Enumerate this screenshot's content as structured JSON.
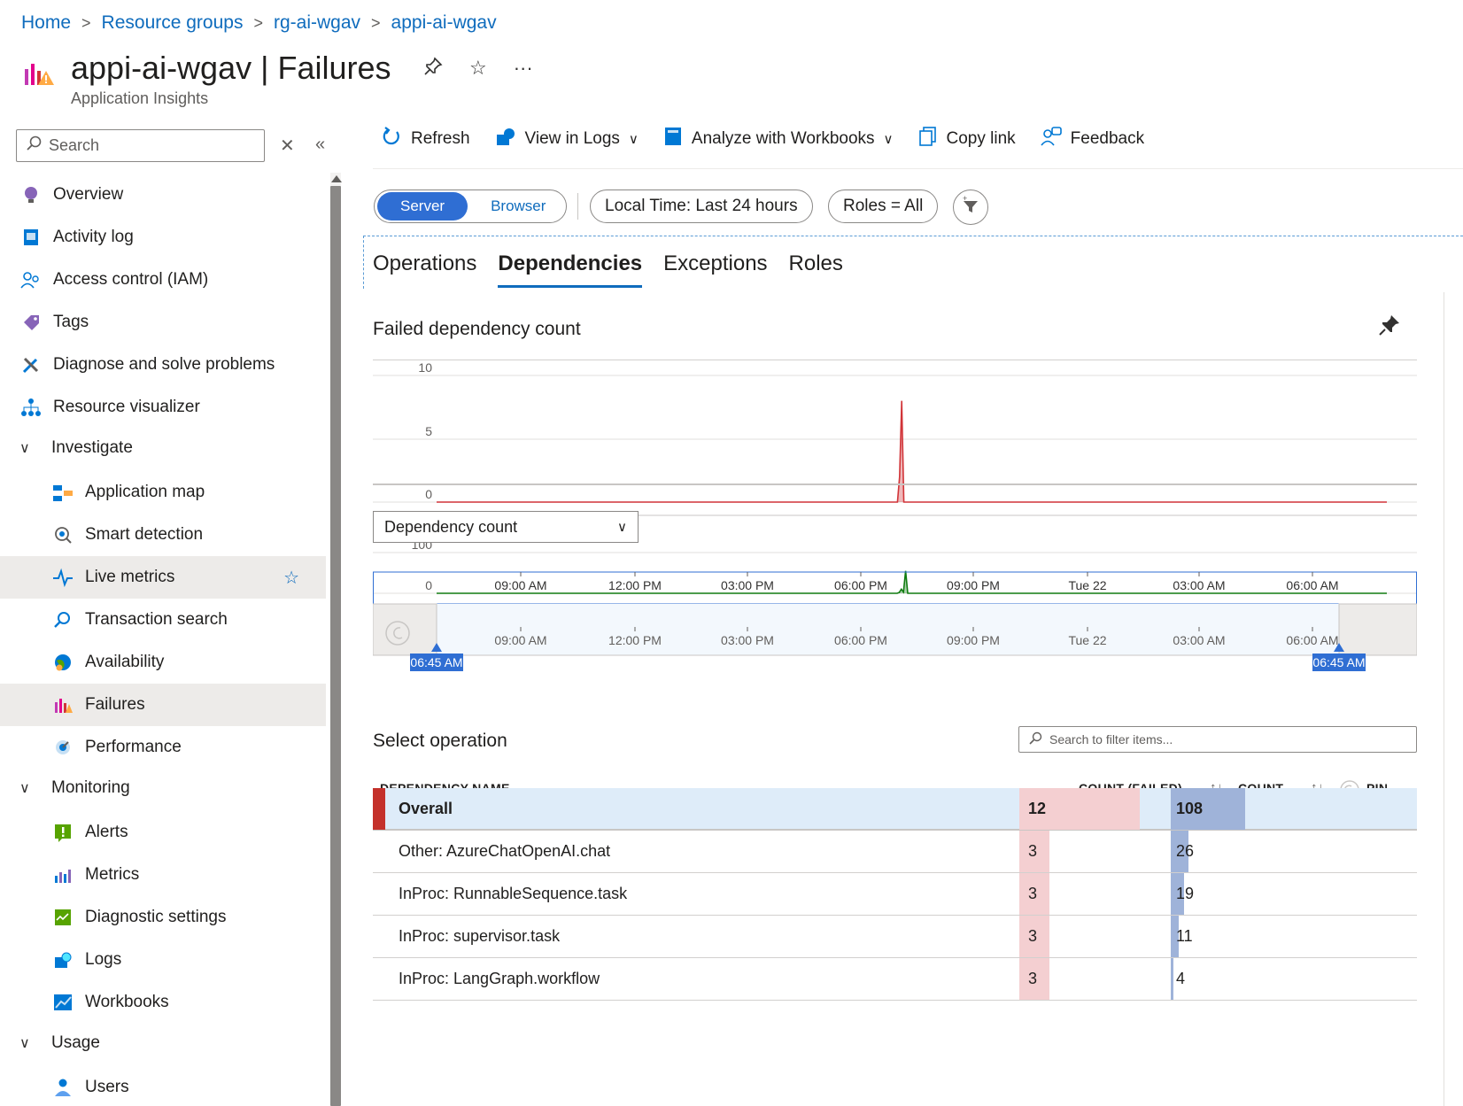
{
  "breadcrumb": [
    "Home",
    "Resource groups",
    "rg-ai-wgav",
    "appi-ai-wgav"
  ],
  "header": {
    "title": "appi-ai-wgav | Failures",
    "subtitle": "Application Insights"
  },
  "sidebar": {
    "search_placeholder": "Search",
    "items": [
      {
        "label": "Overview",
        "icon": "lightbulb-icon"
      },
      {
        "label": "Activity log",
        "icon": "activity-log-icon"
      },
      {
        "label": "Access control (IAM)",
        "icon": "people-icon"
      },
      {
        "label": "Tags",
        "icon": "tag-icon"
      },
      {
        "label": "Diagnose and solve problems",
        "icon": "wrench-icon"
      },
      {
        "label": "Resource visualizer",
        "icon": "hierarchy-icon"
      },
      {
        "label": "Investigate",
        "group": true
      },
      {
        "label": "Application map",
        "icon": "app-map-icon"
      },
      {
        "label": "Smart detection",
        "icon": "smart-detection-icon"
      },
      {
        "label": "Live metrics",
        "icon": "pulse-icon"
      },
      {
        "label": "Transaction search",
        "icon": "search-icon"
      },
      {
        "label": "Availability",
        "icon": "globe-icon"
      },
      {
        "label": "Failures",
        "icon": "failures-icon"
      },
      {
        "label": "Performance",
        "icon": "performance-icon"
      },
      {
        "label": "Monitoring",
        "group": true
      },
      {
        "label": "Alerts",
        "icon": "alert-icon"
      },
      {
        "label": "Metrics",
        "icon": "metrics-icon"
      },
      {
        "label": "Diagnostic settings",
        "icon": "diagnostic-icon"
      },
      {
        "label": "Logs",
        "icon": "logs-icon"
      },
      {
        "label": "Workbooks",
        "icon": "workbooks-icon"
      },
      {
        "label": "Usage",
        "group": true
      },
      {
        "label": "Users",
        "icon": "user-icon"
      }
    ]
  },
  "toolbar": {
    "refresh": "Refresh",
    "view_in_logs": "View in Logs",
    "analyze": "Analyze with Workbooks",
    "copy_link": "Copy link",
    "feedback": "Feedback"
  },
  "filters": {
    "server": "Server",
    "browser": "Browser",
    "time": "Local Time: Last 24 hours",
    "roles": "Roles = All"
  },
  "tabs": [
    "Operations",
    "Dependencies",
    "Exceptions",
    "Roles"
  ],
  "active_tab": "Dependencies",
  "chart_title": "Failed dependency count",
  "dropdown_value": "Dependency count",
  "chart_data": [
    {
      "type": "area",
      "title": "Failed dependency count",
      "yticks": [
        "10",
        "5",
        "0"
      ],
      "ylim": [
        0,
        10
      ],
      "color": "#d13438",
      "x_index": [
        0,
        30,
        31,
        32,
        33,
        34,
        35,
        36,
        60
      ],
      "values": [
        0,
        0,
        0,
        2,
        8,
        0,
        0,
        0,
        0
      ]
    },
    {
      "type": "area",
      "title": "Dependency count",
      "yticks": [
        "100",
        "0"
      ],
      "ylim": [
        0,
        100
      ],
      "color": "#107c10",
      "x_index": [
        0,
        30,
        31,
        32,
        33,
        34,
        35,
        36,
        60
      ],
      "values": [
        0,
        0,
        2,
        10,
        3,
        55,
        0,
        0,
        0
      ]
    }
  ],
  "time_axis": [
    "09:00 AM",
    "12:00 PM",
    "03:00 PM",
    "06:00 PM",
    "09:00 PM",
    "Tue 22",
    "03:00 AM",
    "06:00 AM"
  ],
  "range_labels": {
    "start": "06:45 AM",
    "end": "06:45 AM"
  },
  "table": {
    "section_title": "Select operation",
    "search_placeholder": "Search to filter items...",
    "headers": {
      "name": "DEPENDENCY NAME",
      "failed": "COUNT (FAILED)",
      "count": "COUNT",
      "pin": "PIN"
    },
    "max_failed": 12,
    "max_count": 108,
    "rows": [
      {
        "name": "Overall",
        "failed": 12,
        "count": 108
      },
      {
        "name": "Other: AzureChatOpenAI.chat",
        "failed": 3,
        "count": 26
      },
      {
        "name": "InProc: RunnableSequence.task",
        "failed": 3,
        "count": 19
      },
      {
        "name": "InProc: supervisor.task",
        "failed": 3,
        "count": 11
      },
      {
        "name": "InProc: LangGraph.workflow",
        "failed": 3,
        "count": 4
      }
    ]
  }
}
